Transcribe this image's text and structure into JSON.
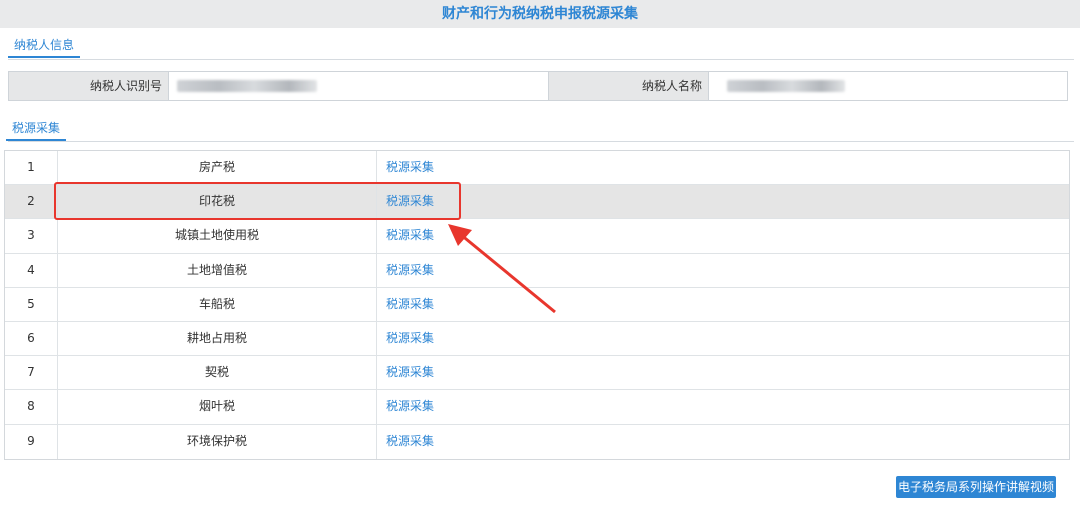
{
  "page": {
    "title": "财产和行为税纳税申报税源采集"
  },
  "tabs": {
    "taxpayer_info": "纳税人信息",
    "source_collection": "税源采集"
  },
  "taxpayer": {
    "id_label": "纳税人识别号",
    "name_label": "纳税人名称"
  },
  "table": {
    "rows": [
      {
        "index": "1",
        "name": "房产税",
        "action": "税源采集"
      },
      {
        "index": "2",
        "name": "印花税",
        "action": "税源采集"
      },
      {
        "index": "3",
        "name": "城镇土地使用税",
        "action": "税源采集"
      },
      {
        "index": "4",
        "name": "土地增值税",
        "action": "税源采集"
      },
      {
        "index": "5",
        "name": "车船税",
        "action": "税源采集"
      },
      {
        "index": "6",
        "name": "耕地占用税",
        "action": "税源采集"
      },
      {
        "index": "7",
        "name": "契税",
        "action": "税源采集"
      },
      {
        "index": "8",
        "name": "烟叶税",
        "action": "税源采集"
      },
      {
        "index": "9",
        "name": "环境保护税",
        "action": "税源采集"
      }
    ],
    "selected_index": "2"
  },
  "footer": {
    "video_button": "电子税务局系列操作讲解视频"
  },
  "colors": {
    "accent": "#2e86d4",
    "annotation": "#e8362d",
    "selected_row": "#e5e5e5"
  }
}
